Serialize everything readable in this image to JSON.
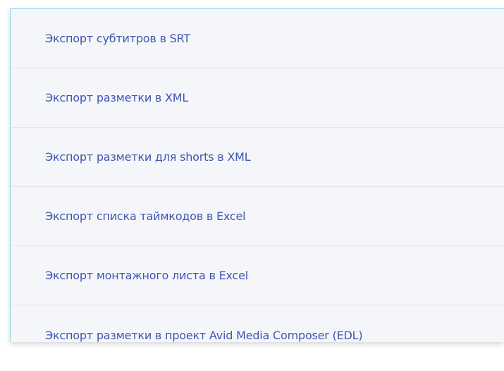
{
  "export_menu": {
    "items": [
      {
        "label": "Экспорт субтитров в SRT"
      },
      {
        "label": "Экспорт разметки в XML"
      },
      {
        "label": "Экспорт разметки для shorts в XML"
      },
      {
        "label": "Экспорт списка таймкодов в Excel"
      },
      {
        "label": "Экспорт монтажного листа в Excel"
      },
      {
        "label": "Экспорт разметки в проект Avid Media Composer (EDL)"
      }
    ]
  },
  "colors": {
    "item_text": "#3f56b0",
    "menu_background": "#f5f6f9",
    "divider": "#e4e6eb",
    "accent_border": "#8fd6ea"
  }
}
